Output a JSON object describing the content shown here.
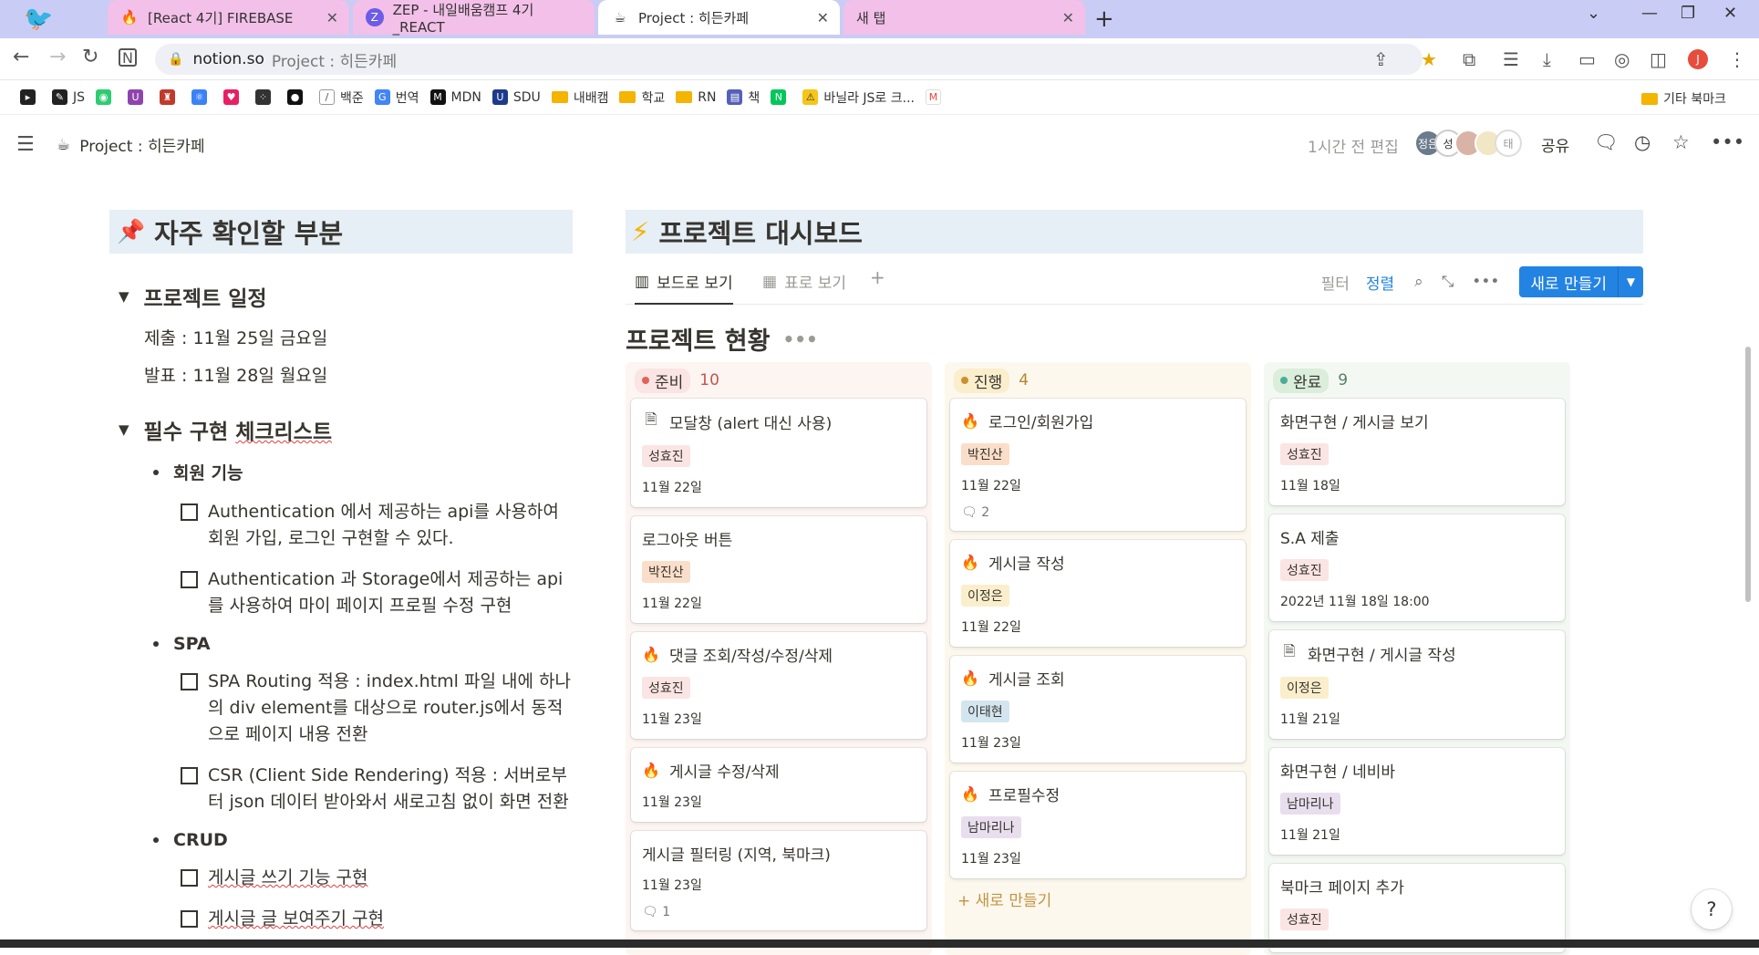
{
  "browser": {
    "tabs": [
      {
        "label": "[React 4기] FIREBASE",
        "icon": "🔥"
      },
      {
        "label": "ZEP - 내일배움캠프 4기_REACT",
        "icon": "Z"
      },
      {
        "label": "Project : 히든카페",
        "icon": "☕"
      },
      {
        "label": "새 탭",
        "icon": ""
      }
    ],
    "url_host": "notion.so",
    "url_path": "Project : 히든카페",
    "profile_initial": "J",
    "bookmarks": [
      "JS",
      "백준",
      "번역",
      "MDN",
      "SDU",
      "내배캠",
      "학교",
      "RN",
      "책",
      "바닐라 JS로 크..."
    ],
    "bookmarks_other": "기타 북마크"
  },
  "notion": {
    "breadcrumb": "Project : 히든카페",
    "edited": "1시간 전 편집",
    "avatars": [
      "정은",
      "성",
      "태"
    ],
    "share": "공유"
  },
  "left": {
    "callout_icon": "📌",
    "callout_title": "자주 확인할 부분",
    "schedule_heading": "프로젝트 일정",
    "schedule": [
      "제출 : 11월 25일 금요일",
      "발표 : 11월 28일 월요일"
    ],
    "checklist_heading_a": "필수 구현 ",
    "checklist_heading_b": "체크리스트",
    "groups": {
      "member": "회원 기능",
      "spa": "SPA",
      "crud": "CRUD"
    },
    "items": {
      "m1": "Authentication 에서 제공하는 api를 사용하여 회원 가입, 로그인 구현할 수 있다.",
      "m2": "Authentication 과 Storage에서 제공하는 api를 사용하여 마이 페이지 프로필 수정 구현",
      "s1": "SPA Routing 적용 : index.html 파일 내에 하나의 div element를 대상으로 router.js에서 동적으로 페이지 내용 전환",
      "s2": "CSR (Client Side Rendering) 적용 : 서버로부터 json 데이터 받아와서 새로고침 없이 화면 전환",
      "c1": "게시글 쓰기 기능 구현",
      "c2": "게시글 글 보여주기 구현"
    }
  },
  "dashboard": {
    "icon": "⚡",
    "title": "프로젝트 대시보드",
    "views": {
      "board": "보드로 보기",
      "table": "표로 보기"
    },
    "filter": "필터",
    "sort": "정렬",
    "new_button": "새로 만들기",
    "board_title": "프로젝트 현황",
    "columns": {
      "todo": {
        "label": "준비",
        "count": "10"
      },
      "doing": {
        "label": "진행",
        "count": "4"
      },
      "done": {
        "label": "완료",
        "count": "9"
      }
    },
    "todo_cards": [
      {
        "title": "모달창 (alert 대신 사용)",
        "tag": "성효진",
        "date": "11월 22일"
      },
      {
        "title": "로그아웃 버튼",
        "tag": "박진산",
        "date": "11월 22일"
      },
      {
        "title": "댓글 조회/작성/수정/삭제",
        "tag": "성효진",
        "date": "11월 23일"
      },
      {
        "title": "게시글 수정/삭제",
        "date": "11월 23일"
      },
      {
        "title": "게시글 필터링 (지역, 북마크)",
        "date": "11월 23일",
        "comments": "1"
      }
    ],
    "doing_cards": [
      {
        "title": "로그인/회원가입",
        "tag": "박진산",
        "date": "11월 22일",
        "comments": "2"
      },
      {
        "title": "게시글 작성",
        "tag": "이정은",
        "date": "11월 22일"
      },
      {
        "title": "게시글 조회",
        "tag": "이태현",
        "date": "11월 23일"
      },
      {
        "title": "프로필수정",
        "tag": "남마리나",
        "date": "11월 23일"
      }
    ],
    "doing_add": "+ 새로 만들기",
    "done_cards": [
      {
        "title": "화면구현 / 게시글 보기",
        "tag": "성효진",
        "date": "11월 18일"
      },
      {
        "title": "S.A 제출",
        "tag": "성효진",
        "date": "2022년 11월 18일 18:00"
      },
      {
        "title": "화면구현 / 게시글 작성",
        "tag": "이정은",
        "date": "11월 21일"
      },
      {
        "title": "화면구현 / 네비바",
        "tag": "남마리나",
        "date": "11월 21일"
      },
      {
        "title": "북마크 페이지 추가",
        "tag": "성효진"
      }
    ]
  },
  "help": "?"
}
